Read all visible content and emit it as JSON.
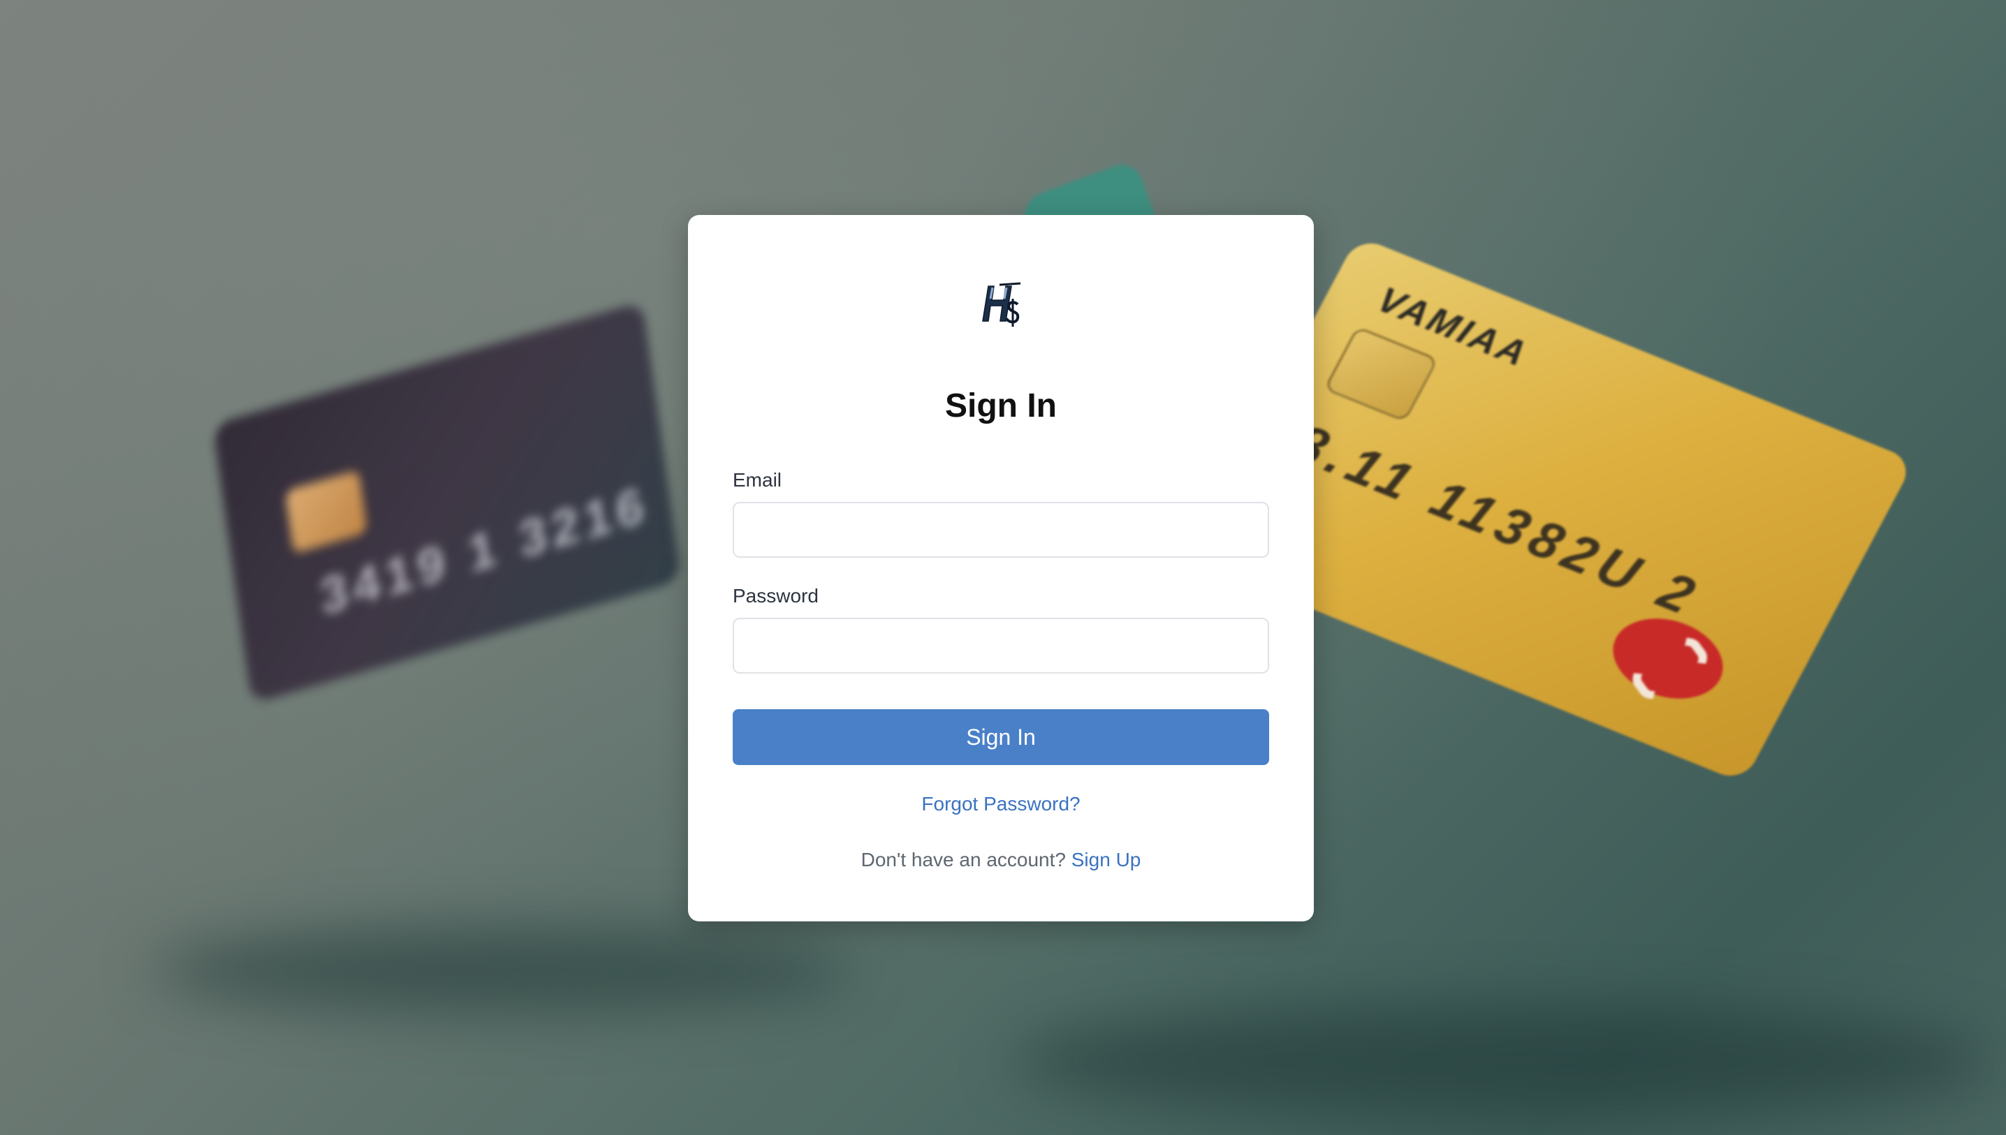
{
  "background": {
    "card_dark_number": "3419 1 3216",
    "card_gold_brand": "VAMIAA",
    "card_gold_number": "8.11 11382U 2"
  },
  "form": {
    "title": "Sign In",
    "email_label": "Email",
    "email_value": "",
    "password_label": "Password",
    "password_value": "",
    "submit_label": "Sign In",
    "forgot_label": "Forgot Password?",
    "signup_prompt": "Don't have an account?",
    "signup_link": "Sign Up"
  },
  "colors": {
    "primary": "#4a80c8",
    "link": "#3a72c0"
  },
  "icons": {
    "logo": "brand-logo-icon"
  }
}
